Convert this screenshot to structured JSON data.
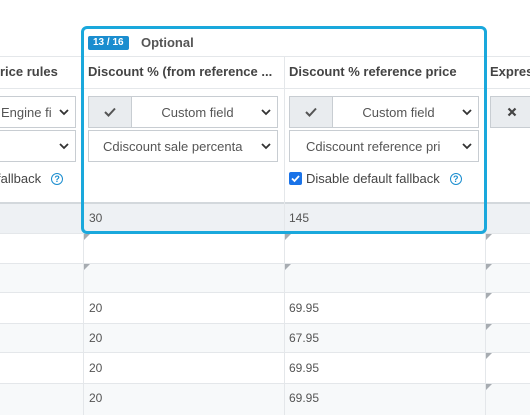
{
  "group": {
    "badge": "13 / 16",
    "title": "Optional"
  },
  "columns": {
    "prev": {
      "header": "rice rules",
      "select1": "Engine fi",
      "select2": "",
      "fallback": "fallback"
    },
    "discount": {
      "header": "Discount % (from reference ...",
      "source_select": "Custom field",
      "field_select": "Cdiscount sale percenta"
    },
    "reference": {
      "header": "Discount % reference price",
      "source_select": "Custom field",
      "field_select": "Cdiscount reference pri",
      "fallback": "Disable default fallback"
    },
    "next": {
      "header": "Expres"
    }
  },
  "rows": [
    {
      "discount": "30",
      "reference": "145"
    },
    {
      "discount": "",
      "reference": ""
    },
    {
      "discount": "",
      "reference": ""
    },
    {
      "discount": "20",
      "reference": "69.95"
    },
    {
      "discount": "20",
      "reference": "67.95"
    },
    {
      "discount": "20",
      "reference": "69.95"
    },
    {
      "discount": "20",
      "reference": "69.95"
    }
  ],
  "icons": {
    "help": "?",
    "check": "check-icon",
    "close": "close-icon",
    "chevron": "chevron-down-icon"
  },
  "colors": {
    "accent": "#1aa8dc",
    "badge": "#1a8dcf",
    "checkbox": "#1a73e8",
    "first_row": "#eef1f4",
    "striped_row": "#f7f9fa"
  }
}
